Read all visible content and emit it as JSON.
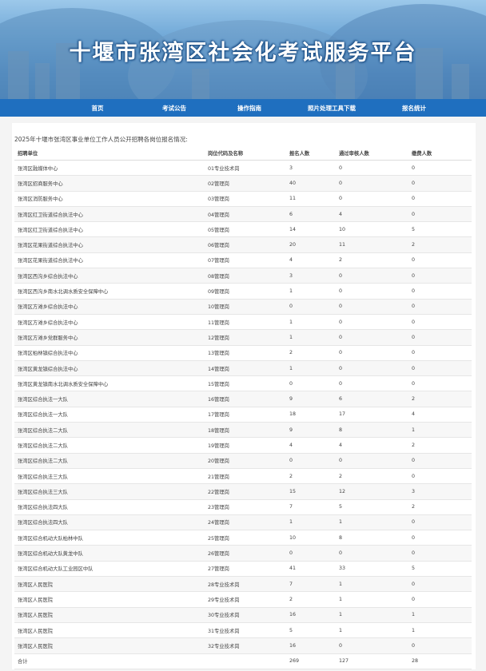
{
  "header": {
    "title": "十堰市张湾区社会化考试服务平台"
  },
  "nav": {
    "items": [
      "首页",
      "考试公告",
      "操作指南",
      "照片处理工具下载",
      "报名统计"
    ]
  },
  "main": {
    "caption": "2025年十堰市张湾区事业单位工作人员公开招聘各岗位报名情况:",
    "columns": [
      "招聘单位",
      "岗位代码及名称",
      "报名人数",
      "通过审核人数",
      "缴费人数"
    ],
    "rows": [
      [
        "张湾区融媒体中心",
        "01专业技术岗",
        "3",
        "0",
        "0"
      ],
      [
        "张湾区招商服务中心",
        "02管理岗",
        "40",
        "0",
        "0"
      ],
      [
        "张湾区消防服务中心",
        "03管理岗",
        "11",
        "0",
        "0"
      ],
      [
        "张湾区红卫街道综合执法中心",
        "04管理岗",
        "6",
        "4",
        "0"
      ],
      [
        "张湾区红卫街道综合执法中心",
        "05管理岗",
        "14",
        "10",
        "5"
      ],
      [
        "张湾区花果街道综合执法中心",
        "06管理岗",
        "20",
        "11",
        "2"
      ],
      [
        "张湾区花果街道综合执法中心",
        "07管理岗",
        "4",
        "2",
        "0"
      ],
      [
        "张湾区西沟乡综合执法中心",
        "08管理岗",
        "3",
        "0",
        "0"
      ],
      [
        "张湾区西沟乡南水北调水质安全保障中心",
        "09管理岗",
        "1",
        "0",
        "0"
      ],
      [
        "张湾区方滩乡综合执法中心",
        "10管理岗",
        "0",
        "0",
        "0"
      ],
      [
        "张湾区方滩乡综合执法中心",
        "11管理岗",
        "1",
        "0",
        "0"
      ],
      [
        "张湾区方滩乡党群服务中心",
        "12管理岗",
        "1",
        "0",
        "0"
      ],
      [
        "张湾区柏林镇综合执法中心",
        "13管理岗",
        "2",
        "0",
        "0"
      ],
      [
        "张湾区黄龙镇综合执法中心",
        "14管理岗",
        "1",
        "0",
        "0"
      ],
      [
        "张湾区黄龙镇南水北调水质安全保障中心",
        "15管理岗",
        "0",
        "0",
        "0"
      ],
      [
        "张湾区综合执法一大队",
        "16管理岗",
        "9",
        "6",
        "2"
      ],
      [
        "张湾区综合执法一大队",
        "17管理岗",
        "18",
        "17",
        "4"
      ],
      [
        "张湾区综合执法二大队",
        "18管理岗",
        "9",
        "8",
        "1"
      ],
      [
        "张湾区综合执法二大队",
        "19管理岗",
        "4",
        "4",
        "2"
      ],
      [
        "张湾区综合执法二大队",
        "20管理岗",
        "0",
        "0",
        "0"
      ],
      [
        "张湾区综合执法三大队",
        "21管理岗",
        "2",
        "2",
        "0"
      ],
      [
        "张湾区综合执法三大队",
        "22管理岗",
        "15",
        "12",
        "3"
      ],
      [
        "张湾区综合执法四大队",
        "23管理岗",
        "7",
        "5",
        "2"
      ],
      [
        "张湾区综合执法四大队",
        "24管理岗",
        "1",
        "1",
        "0"
      ],
      [
        "张湾区综合机动大队柏林中队",
        "25管理岗",
        "10",
        "8",
        "0"
      ],
      [
        "张湾区综合机动大队黄龙中队",
        "26管理岗",
        "0",
        "0",
        "0"
      ],
      [
        "张湾区综合机动大队工业园区中队",
        "27管理岗",
        "41",
        "33",
        "5"
      ],
      [
        "张湾区人民医院",
        "28专业技术岗",
        "7",
        "1",
        "0"
      ],
      [
        "张湾区人民医院",
        "29专业技术岗",
        "2",
        "1",
        "0"
      ],
      [
        "张湾区人民医院",
        "30专业技术岗",
        "16",
        "1",
        "1"
      ],
      [
        "张湾区人民医院",
        "31专业技术岗",
        "5",
        "1",
        "1"
      ],
      [
        "张湾区人民医院",
        "32专业技术岗",
        "16",
        "0",
        "0"
      ]
    ],
    "total": [
      "合计",
      "",
      "269",
      "127",
      "28"
    ]
  }
}
